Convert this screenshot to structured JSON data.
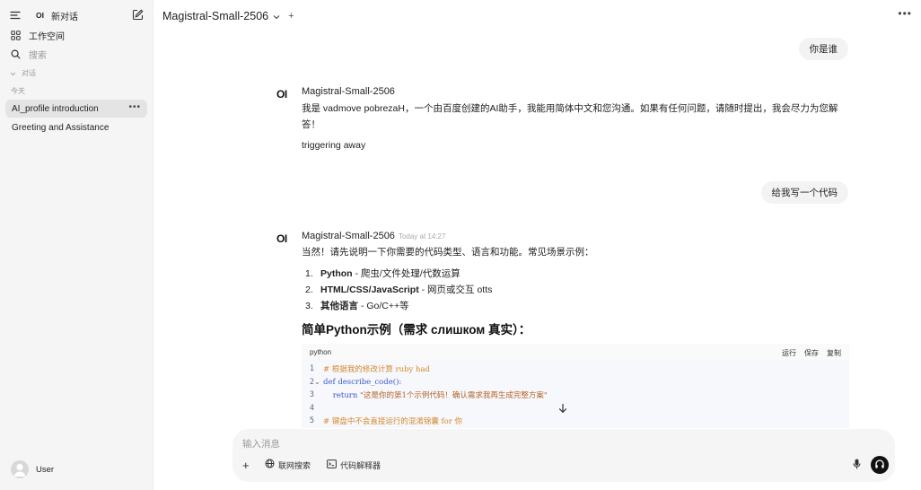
{
  "sidebar": {
    "logo": "OI",
    "new_chat_label": "新对话",
    "workspace_label": "工作空间",
    "search_label": "搜索",
    "section_label": "对话",
    "date_group": "今天",
    "chats": [
      {
        "title": "AI_profile introduction",
        "active": true
      },
      {
        "title": "Greeting and Assistance",
        "active": false
      }
    ],
    "user_name": "User"
  },
  "header": {
    "model_name": "Magistral-Small-2506"
  },
  "messages": [
    {
      "role": "user",
      "text": "你是谁"
    },
    {
      "role": "assistant",
      "logo": "OI",
      "model": "Magistral-Small-2506",
      "text": "我是 vadmove pobrezaH，一个由百度创建的AI助手，我能用简体中文和您沟通。如果有任何问题，请随时提出，我会尽力为您解答！",
      "extra": "triggering away"
    },
    {
      "role": "user",
      "text": "给我写一个代码"
    },
    {
      "role": "assistant",
      "logo": "OI",
      "model": "Magistral-Small-2506",
      "time": "Today at 14:27",
      "intro": "当然！请先说明一下你需要的代码类型、语言和功能。常见场景示例：",
      "list": [
        {
          "num": "1.",
          "bold": "Python",
          "rest": " - 爬虫/文件处理/代数运算"
        },
        {
          "num": "2.",
          "bold": "HTML/CSS/JavaScript",
          "rest": " - 网页或交互 otts"
        },
        {
          "num": "3.",
          "bold": "其他语言",
          "rest": " - Go/C++等"
        }
      ],
      "heading": "简单Python示例（需求 слишком 真实）：",
      "code": {
        "language": "python",
        "actions": [
          "运行",
          "保存",
          "复制"
        ],
        "lines": [
          {
            "no": "1",
            "fold": "",
            "parts": [
              {
                "t": "# 根据我的修改计算 ruby had",
                "c": "c-comment"
              }
            ]
          },
          {
            "no": "2",
            "fold": "⌄",
            "parts": [
              {
                "t": "def ",
                "c": "c-key"
              },
              {
                "t": "describe_code",
                "c": "c-key"
              },
              {
                "t": "():",
                "c": "c-key"
              }
            ]
          },
          {
            "no": "3",
            "fold": "",
            "parts": [
              {
                "t": "    return ",
                "c": "c-key"
              },
              {
                "t": "\"这是你的第1个示例代码！确认需求我再生成完整方案\"",
                "c": "c-str"
              }
            ]
          },
          {
            "no": "4",
            "fold": "",
            "parts": []
          },
          {
            "no": "5",
            "fold": "",
            "parts": [
              {
                "t": "# 键盘中不会直接运行的混淆锦囊 for 你",
                "c": "c-comment"
              }
            ]
          }
        ]
      }
    }
  ],
  "input": {
    "placeholder": "输入消息",
    "web_search_label": "联网搜索",
    "code_interpreter_label": "代码解释器"
  }
}
